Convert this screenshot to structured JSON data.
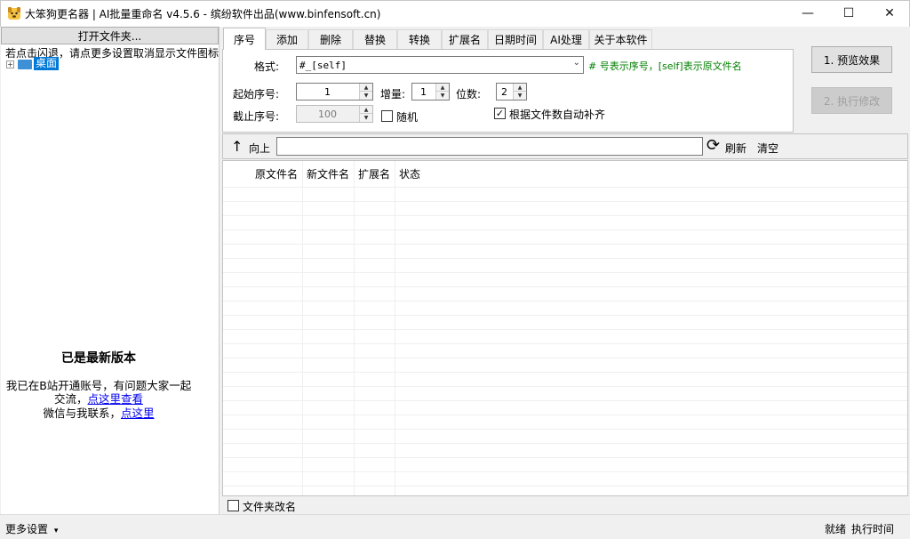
{
  "window": {
    "title": "大笨狗更名器 | AI批量重命名 v4.5.6 - 缤纷软件出品(www.binfensoft.cn)",
    "minimize_glyph": "—",
    "maximize_glyph": "☐",
    "close_glyph": "✕"
  },
  "left": {
    "open_folder_label": "打开文件夹...",
    "hint": "若点击闪退，请点更多设置取消显示文件图标",
    "tree": {
      "expander": "+",
      "desktop_label": "桌面"
    },
    "latest_version": "已是最新版本",
    "bili_prefix": "我已在B站开通账号，有问题大家一起交流，",
    "bili_link": "点这里查看",
    "wechat_prefix": "微信与我联系，",
    "wechat_link": "点这里"
  },
  "tabs": [
    {
      "label": "序号",
      "active": true
    },
    {
      "label": "添加"
    },
    {
      "label": "删除"
    },
    {
      "label": "替换"
    },
    {
      "label": "转换"
    },
    {
      "label": "扩展名"
    },
    {
      "label": "日期时间"
    },
    {
      "label": "AI处理"
    },
    {
      "label": "关于本软件"
    }
  ],
  "serial_tab": {
    "format_label": "格式:",
    "format_value": "#_[self]",
    "format_hint": "# 号表示序号，[self]表示原文件名",
    "start_label": "起始序号:",
    "start_value": "1",
    "step_label": "增量:",
    "step_value": "1",
    "digits_label": "位数:",
    "digits_value": "2",
    "end_label": "截止序号:",
    "end_value": "100",
    "random_label": "随机",
    "random_checked": false,
    "auto_pad_label": "根据文件数自动补齐",
    "auto_pad_checked": true
  },
  "actions": {
    "preview_label": "1. 预览效果",
    "execute_label": "2. 执行修改"
  },
  "pathbar": {
    "up_icon": "↑",
    "up_label": "向上",
    "path_value": "",
    "refresh_icon": "⟳",
    "refresh_label": "刷新",
    "clear_label": "清空"
  },
  "list": {
    "columns": [
      "原文件名",
      "新文件名",
      "扩展名",
      "状态"
    ]
  },
  "folder_rename": {
    "label": "文件夹改名",
    "checked": false
  },
  "status": {
    "more_settings": "更多设置",
    "dropdown_icon": "▾",
    "state": "就绪",
    "exec_time_label": "执行时间"
  },
  "colors": {
    "hint_green": "#008000",
    "selection_blue": "#0078d7",
    "link_blue": "#0000ee"
  }
}
